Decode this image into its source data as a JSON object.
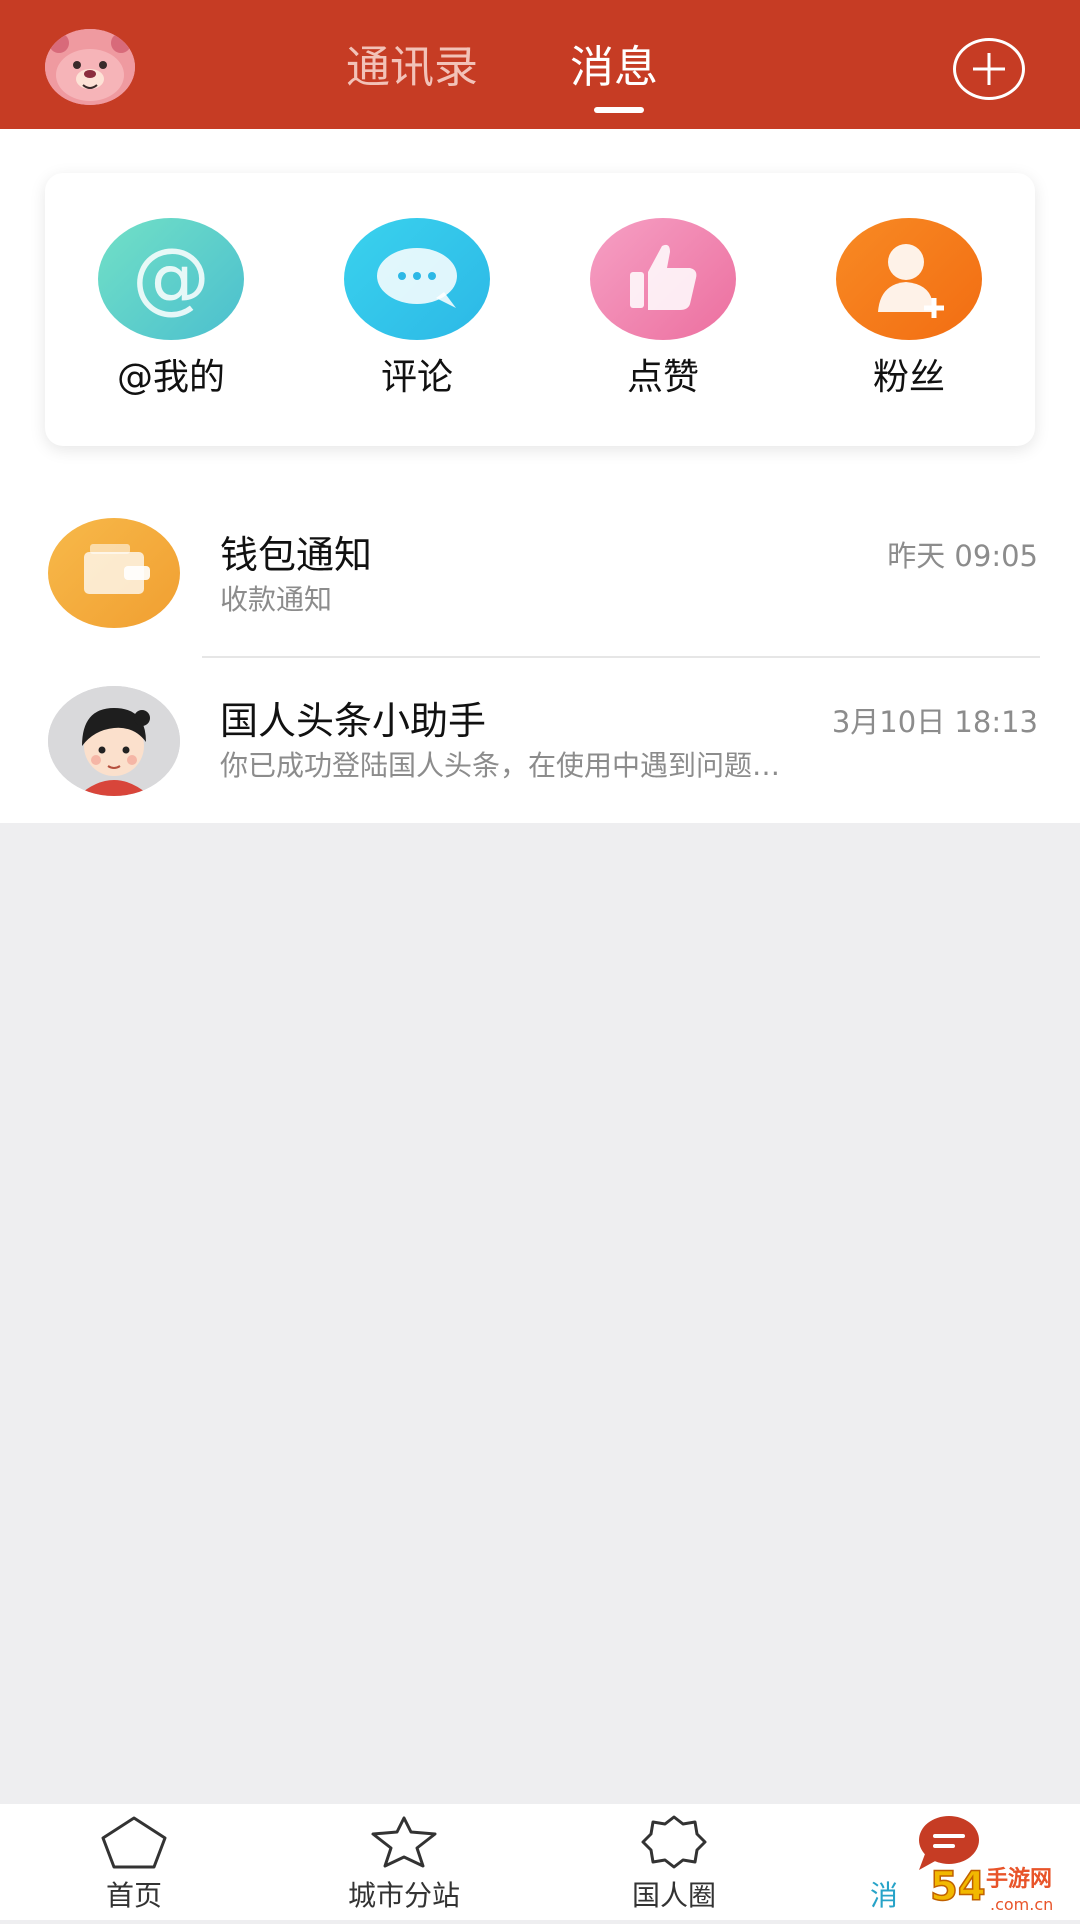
{
  "colors": {
    "brand": "#c63c24",
    "at_circle": "#5fd3c3",
    "comment_circle": "#35c8ea",
    "like_circle": "#f27fac",
    "fans_circle": "#f57a1c",
    "wallet_circle": "#f4ae3c",
    "active_nav": "#c63c24"
  },
  "header": {
    "tabs": [
      {
        "label": "通讯录",
        "active": false
      },
      {
        "label": "消息",
        "active": true
      }
    ],
    "add_icon": "plus-circle-icon",
    "avatar_icon": "pink-bear-avatar"
  },
  "quick_actions": [
    {
      "label": "@我的",
      "icon": "at-icon"
    },
    {
      "label": "评论",
      "icon": "comment-bubble-icon"
    },
    {
      "label": "点赞",
      "icon": "thumbs-up-icon"
    },
    {
      "label": "粉丝",
      "icon": "add-user-icon"
    }
  ],
  "messages": [
    {
      "title": "钱包通知",
      "subtitle": "收款通知",
      "time": "昨天 09:05",
      "icon": "wallet-icon"
    },
    {
      "title": "国人头条小助手",
      "subtitle": "你已成功登陆国人头条，在使用中遇到问题…",
      "time": "3月10日 18:13",
      "icon": "cartoon-avatar"
    }
  ],
  "bottom_nav": [
    {
      "label": "首页",
      "icon": "pentagon-icon",
      "active": false
    },
    {
      "label": "城市分站",
      "icon": "star-outline-icon",
      "active": false
    },
    {
      "label": "国人圈",
      "icon": "badge-outline-icon",
      "active": false
    },
    {
      "label": "消",
      "icon": "message-bubble-icon",
      "active": true
    }
  ],
  "watermark": {
    "text": "54计手游网",
    "sub": ".com.cn"
  }
}
